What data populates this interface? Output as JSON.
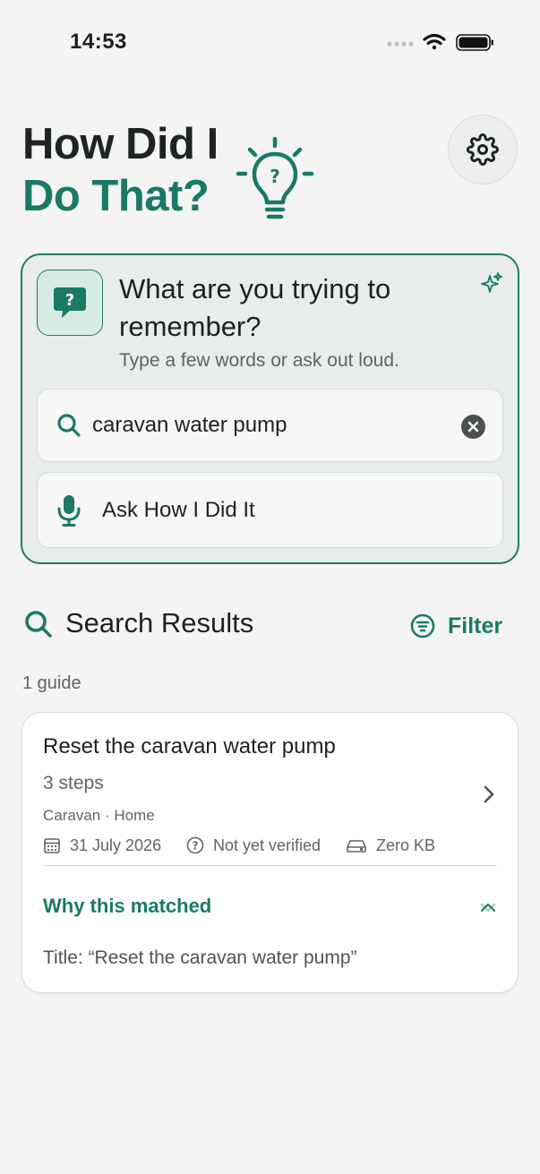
{
  "status_bar": {
    "time": "14:53",
    "icons": [
      "signal-dots-icon",
      "wifi-icon",
      "battery-icon"
    ]
  },
  "header": {
    "title_line1": "How Did I",
    "title_line2": "Do That?",
    "logo_icon": "lightbulb-question-icon",
    "settings_icon": "gear-icon"
  },
  "prompt": {
    "title": "What are you trying to remember?",
    "subtitle": "Type a few words or ask out loud.",
    "icon": "chat-question-icon",
    "sparkle_icon": "sparkle-icon"
  },
  "search": {
    "value": "caravan water pump",
    "search_icon": "search-icon",
    "clear_icon": "clear-icon"
  },
  "ask": {
    "label": "Ask How I Did It",
    "icon": "microphone-icon"
  },
  "results": {
    "title": "Search Results",
    "filter_label": "Filter",
    "count_label": "1 guide",
    "items": [
      {
        "title": "Reset the caravan water pump",
        "steps": "3 steps",
        "tags": "Caravan · Home",
        "date": "31 July 2026",
        "verified": "Not yet verified",
        "size": "Zero KB",
        "why_label": "Why this matched",
        "why_detail": "Title: “Reset the caravan water pump”"
      }
    ]
  },
  "colors": {
    "accent": "#197a66",
    "background": "#f3f4f3",
    "card": "#ffffff",
    "prompt_card": "#e8ecea"
  }
}
